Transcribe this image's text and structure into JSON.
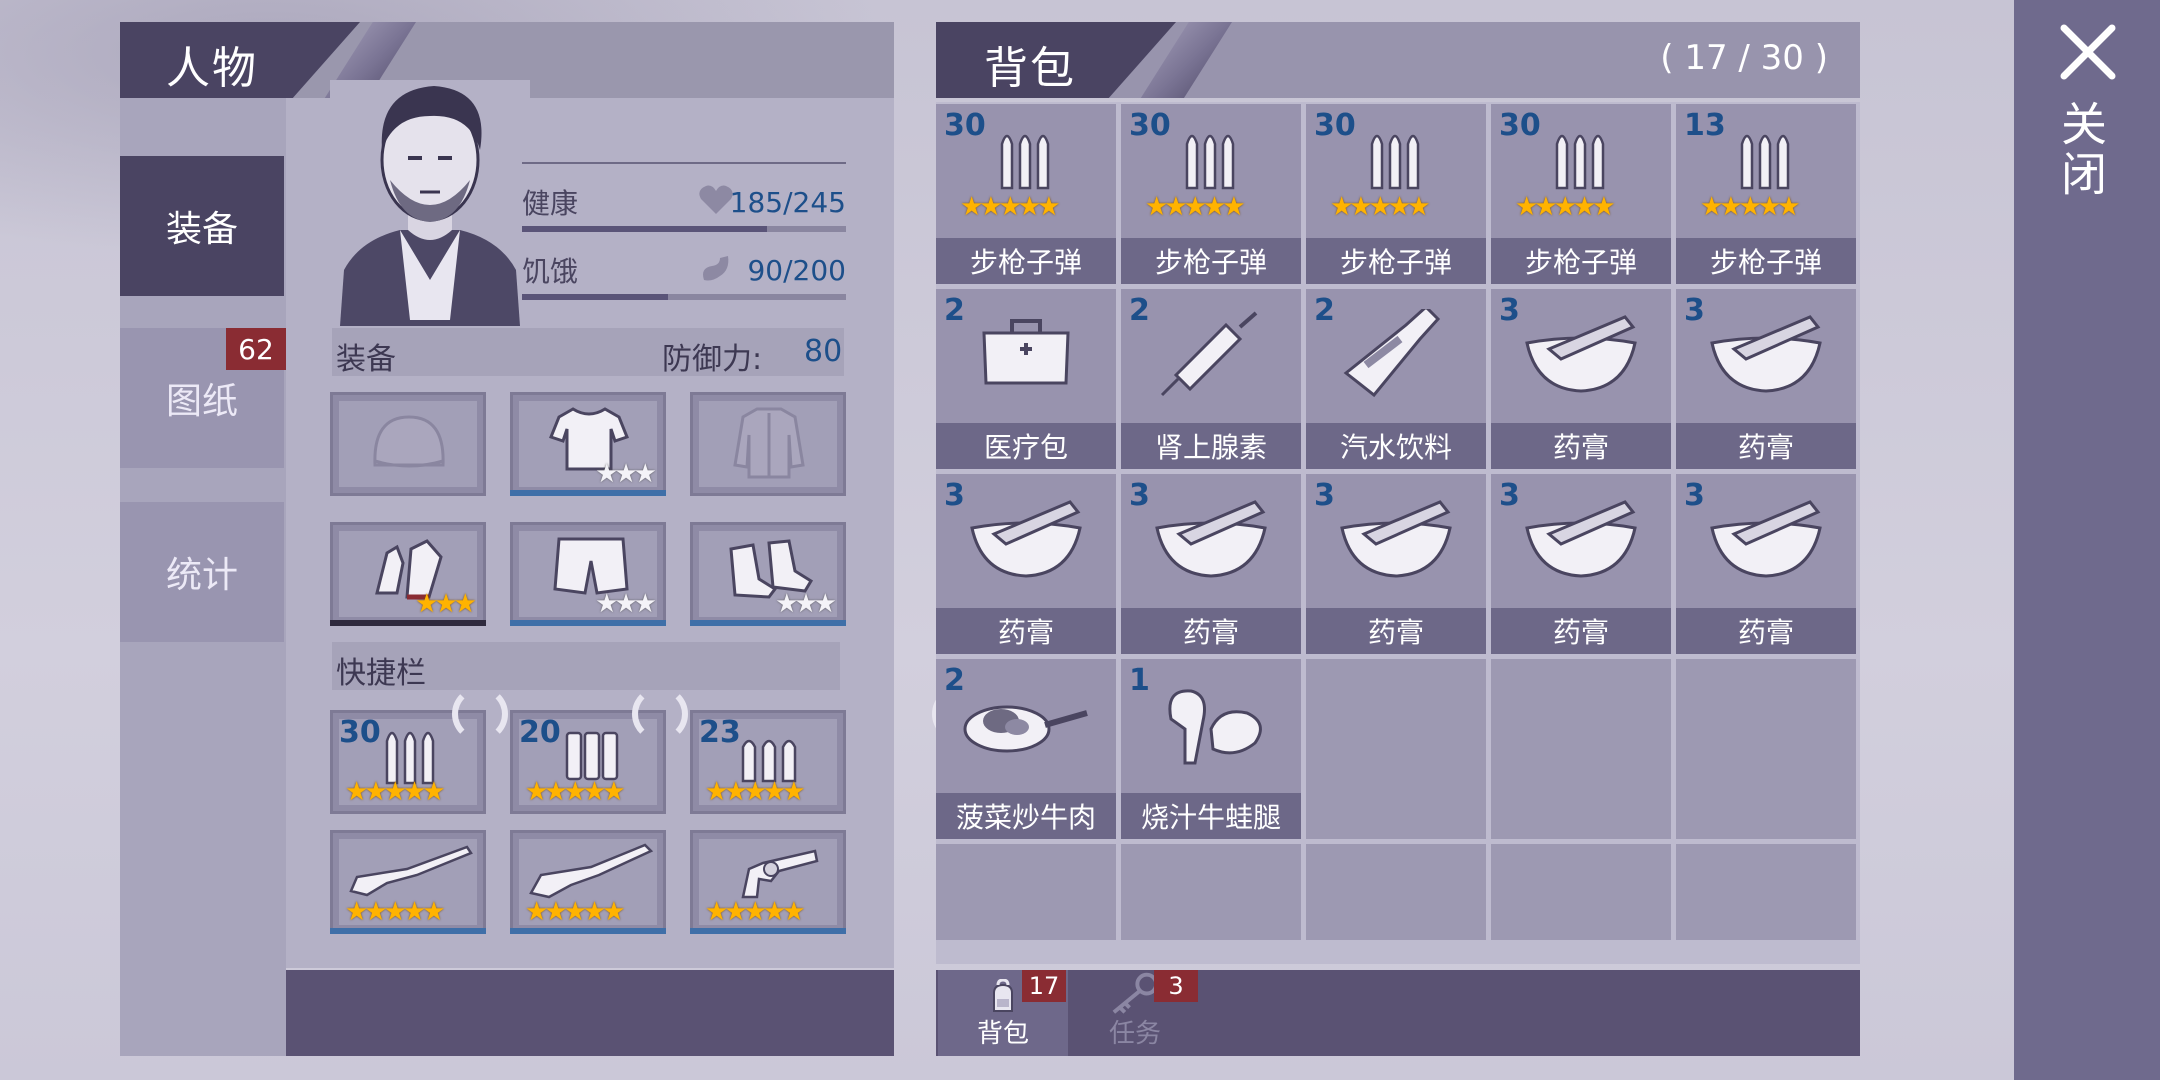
{
  "character_panel": {
    "title": "人物",
    "tabs": [
      {
        "label": "装备",
        "active": true
      },
      {
        "label": "图纸",
        "badge": "62"
      },
      {
        "label": "统计"
      }
    ],
    "stats": [
      {
        "label": "健康",
        "icon": "heart-icon",
        "value": "185/245",
        "fraction": 0.755
      },
      {
        "label": "饥饿",
        "icon": "stomach-icon",
        "value": "90/200",
        "fraction": 0.45
      }
    ],
    "equipment": {
      "label": "装备",
      "defense_label": "防御力:",
      "defense_value": "80",
      "slots": [
        {
          "icon": "hat-icon",
          "stars": 0
        },
        {
          "icon": "shirt-icon",
          "stars": 3,
          "star_color": "white"
        },
        {
          "icon": "jacket-icon",
          "stars": 0
        },
        {
          "icon": "gloves-icon",
          "stars": 3,
          "star_color": "gold"
        },
        {
          "icon": "shorts-icon",
          "stars": 3,
          "star_color": "white"
        },
        {
          "icon": "shoes-icon",
          "stars": 3,
          "star_color": "white"
        }
      ]
    },
    "quickbar": {
      "label": "快捷栏",
      "ammo": [
        {
          "count": "30",
          "icon": "rifle-ammo-icon",
          "stars": 5
        },
        {
          "count": "20",
          "icon": "shotgun-shells-icon",
          "stars": 5
        },
        {
          "count": "23",
          "icon": "pistol-ammo-icon",
          "stars": 5
        }
      ],
      "weapons": [
        {
          "icon": "rifle-icon",
          "stars": 5
        },
        {
          "icon": "shotgun-icon",
          "stars": 5
        },
        {
          "icon": "revolver-icon",
          "stars": 5
        }
      ]
    }
  },
  "backpack": {
    "title": "背包",
    "capacity": "( 17 / 30 )",
    "items": [
      {
        "count": "30",
        "name": "步枪子弹",
        "icon": "rifle-ammo-icon",
        "stars": 5
      },
      {
        "count": "30",
        "name": "步枪子弹",
        "icon": "rifle-ammo-icon",
        "stars": 5
      },
      {
        "count": "30",
        "name": "步枪子弹",
        "icon": "rifle-ammo-icon",
        "stars": 5
      },
      {
        "count": "30",
        "name": "步枪子弹",
        "icon": "rifle-ammo-icon",
        "stars": 5
      },
      {
        "count": "13",
        "name": "步枪子弹",
        "icon": "rifle-ammo-icon",
        "stars": 5
      },
      {
        "count": "2",
        "name": "医疗包",
        "icon": "medkit-icon"
      },
      {
        "count": "2",
        "name": "肾上腺素",
        "icon": "syringe-icon"
      },
      {
        "count": "2",
        "name": "汽水饮料",
        "icon": "soda-bottle-icon"
      },
      {
        "count": "3",
        "name": "药膏",
        "icon": "mortar-pestle-icon"
      },
      {
        "count": "3",
        "name": "药膏",
        "icon": "mortar-pestle-icon"
      },
      {
        "count": "3",
        "name": "药膏",
        "icon": "mortar-pestle-icon"
      },
      {
        "count": "3",
        "name": "药膏",
        "icon": "mortar-pestle-icon"
      },
      {
        "count": "3",
        "name": "药膏",
        "icon": "mortar-pestle-icon"
      },
      {
        "count": "3",
        "name": "药膏",
        "icon": "mortar-pestle-icon"
      },
      {
        "count": "3",
        "name": "药膏",
        "icon": "mortar-pestle-icon"
      },
      {
        "count": "2",
        "name": "菠菜炒牛肉",
        "icon": "frying-pan-icon"
      },
      {
        "count": "1",
        "name": "烧汁牛蛙腿",
        "icon": "frog-legs-icon"
      }
    ],
    "total_slots": 25,
    "bottom_tabs": [
      {
        "label": "背包",
        "badge": "17",
        "icon": "backpack-icon",
        "active": true
      },
      {
        "label": "任务",
        "badge": "3",
        "icon": "key-icon",
        "active": false
      }
    ]
  },
  "close": {
    "label": "关闭",
    "icon": "close-icon"
  },
  "colors": {
    "accent_dark": "#4a4462",
    "badge_red": "#8a2c33",
    "number_blue": "#1d4f8a",
    "star_gold": "#ffb300"
  }
}
